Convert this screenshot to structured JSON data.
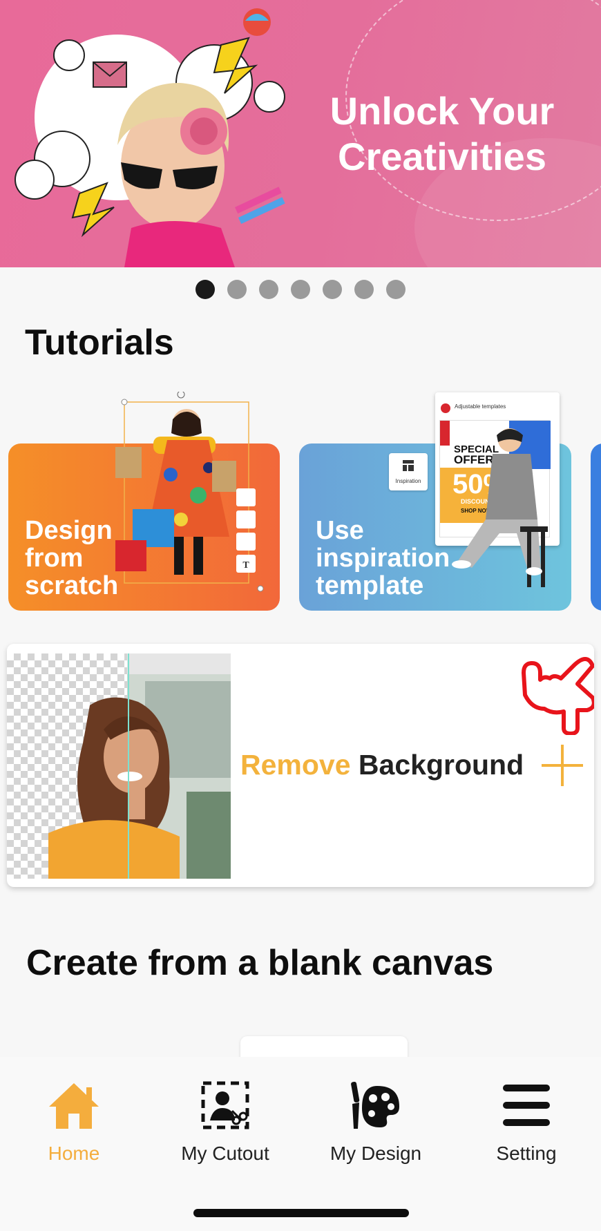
{
  "banner": {
    "title": "Unlock Your Creativities"
  },
  "carousel": {
    "count": 7,
    "active_index": 0
  },
  "tutorials": {
    "title": "Tutorials",
    "cards": [
      {
        "label": "Design\nfrom\nscratch"
      },
      {
        "label": "Use\ninspiration\ntemplate"
      }
    ],
    "template_badge": "Inspiration",
    "template_header": "Adjustable templates",
    "template_offer_line1": "SPECIAL",
    "template_offer_line2": "OFFER",
    "template_percent": "50%",
    "template_discount": "DISCOUNT",
    "template_cta": "SHOP NOW!"
  },
  "remove_background": {
    "highlight": "Remove",
    "rest": "Background"
  },
  "blank_canvas": {
    "title": "Create from a blank canvas"
  },
  "tabbar": {
    "tabs": [
      {
        "label": "Home",
        "icon": "home-icon",
        "active": true
      },
      {
        "label": "My Cutout",
        "icon": "cutout-icon"
      },
      {
        "label": "My Design",
        "icon": "palette-icon"
      },
      {
        "label": "Setting",
        "icon": "menu-icon"
      }
    ]
  },
  "colors": {
    "accent": "#f4ad3d",
    "banner": "#e86a99",
    "orange_card": "#f58f28",
    "blue_card": "#6aa2d8",
    "hand": "#e8141b"
  }
}
